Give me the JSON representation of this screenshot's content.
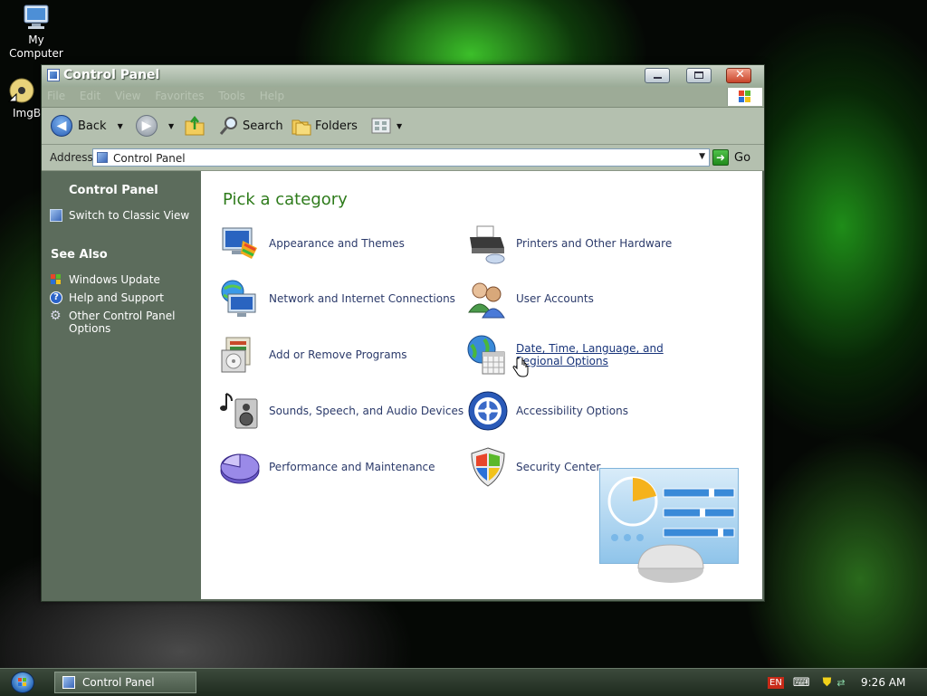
{
  "desktop": {
    "icons": [
      {
        "label": "My Computer"
      },
      {
        "label": "ImgB"
      }
    ]
  },
  "window": {
    "title": "Control Panel",
    "menu": [
      "File",
      "Edit",
      "View",
      "Favorites",
      "Tools",
      "Help"
    ],
    "toolbar": {
      "back_label": "Back",
      "search_label": "Search",
      "folders_label": "Folders"
    },
    "address": {
      "label": "Address",
      "value": "Control Panel",
      "go_label": "Go"
    },
    "leftpane": {
      "panel_title": "Control Panel",
      "switch_view": "Switch to Classic View",
      "see_also_title": "See Also",
      "see_also": [
        "Windows Update",
        "Help and Support",
        "Other Control Panel Options"
      ]
    },
    "content": {
      "heading": "Pick a category",
      "categories": [
        {
          "label": "Appearance and Themes"
        },
        {
          "label": "Printers and Other Hardware"
        },
        {
          "label": "Network and Internet Connections"
        },
        {
          "label": "User Accounts"
        },
        {
          "label": "Add or Remove Programs"
        },
        {
          "label": "Date, Time, Language, and Regional Options"
        },
        {
          "label": "Sounds, Speech, and Audio Devices"
        },
        {
          "label": "Accessibility Options"
        },
        {
          "label": "Performance and Maintenance"
        },
        {
          "label": "Security Center"
        }
      ]
    }
  },
  "taskbar": {
    "task_label": "Control Panel",
    "language": "EN",
    "clock": "9:26 AM"
  },
  "colors": {
    "heading_green": "#2e7b1b",
    "link_blue": "#18347a",
    "leftpane_bg": "#5c6c5c"
  }
}
